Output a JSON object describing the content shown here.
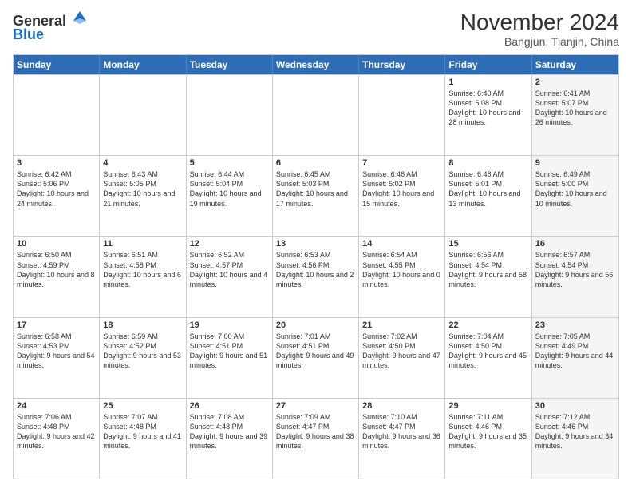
{
  "header": {
    "logo_line1": "General",
    "logo_line2": "Blue",
    "month_title": "November 2024",
    "subtitle": "Bangjun, Tianjin, China"
  },
  "weekdays": [
    "Sunday",
    "Monday",
    "Tuesday",
    "Wednesday",
    "Thursday",
    "Friday",
    "Saturday"
  ],
  "rows": [
    [
      {
        "day": "",
        "text": "",
        "shaded": false
      },
      {
        "day": "",
        "text": "",
        "shaded": false
      },
      {
        "day": "",
        "text": "",
        "shaded": false
      },
      {
        "day": "",
        "text": "",
        "shaded": false
      },
      {
        "day": "",
        "text": "",
        "shaded": false
      },
      {
        "day": "1",
        "text": "Sunrise: 6:40 AM\nSunset: 5:08 PM\nDaylight: 10 hours and 28 minutes.",
        "shaded": false
      },
      {
        "day": "2",
        "text": "Sunrise: 6:41 AM\nSunset: 5:07 PM\nDaylight: 10 hours and 26 minutes.",
        "shaded": true
      }
    ],
    [
      {
        "day": "3",
        "text": "Sunrise: 6:42 AM\nSunset: 5:06 PM\nDaylight: 10 hours and 24 minutes.",
        "shaded": false
      },
      {
        "day": "4",
        "text": "Sunrise: 6:43 AM\nSunset: 5:05 PM\nDaylight: 10 hours and 21 minutes.",
        "shaded": false
      },
      {
        "day": "5",
        "text": "Sunrise: 6:44 AM\nSunset: 5:04 PM\nDaylight: 10 hours and 19 minutes.",
        "shaded": false
      },
      {
        "day": "6",
        "text": "Sunrise: 6:45 AM\nSunset: 5:03 PM\nDaylight: 10 hours and 17 minutes.",
        "shaded": false
      },
      {
        "day": "7",
        "text": "Sunrise: 6:46 AM\nSunset: 5:02 PM\nDaylight: 10 hours and 15 minutes.",
        "shaded": false
      },
      {
        "day": "8",
        "text": "Sunrise: 6:48 AM\nSunset: 5:01 PM\nDaylight: 10 hours and 13 minutes.",
        "shaded": false
      },
      {
        "day": "9",
        "text": "Sunrise: 6:49 AM\nSunset: 5:00 PM\nDaylight: 10 hours and 10 minutes.",
        "shaded": true
      }
    ],
    [
      {
        "day": "10",
        "text": "Sunrise: 6:50 AM\nSunset: 4:59 PM\nDaylight: 10 hours and 8 minutes.",
        "shaded": false
      },
      {
        "day": "11",
        "text": "Sunrise: 6:51 AM\nSunset: 4:58 PM\nDaylight: 10 hours and 6 minutes.",
        "shaded": false
      },
      {
        "day": "12",
        "text": "Sunrise: 6:52 AM\nSunset: 4:57 PM\nDaylight: 10 hours and 4 minutes.",
        "shaded": false
      },
      {
        "day": "13",
        "text": "Sunrise: 6:53 AM\nSunset: 4:56 PM\nDaylight: 10 hours and 2 minutes.",
        "shaded": false
      },
      {
        "day": "14",
        "text": "Sunrise: 6:54 AM\nSunset: 4:55 PM\nDaylight: 10 hours and 0 minutes.",
        "shaded": false
      },
      {
        "day": "15",
        "text": "Sunrise: 6:56 AM\nSunset: 4:54 PM\nDaylight: 9 hours and 58 minutes.",
        "shaded": false
      },
      {
        "day": "16",
        "text": "Sunrise: 6:57 AM\nSunset: 4:54 PM\nDaylight: 9 hours and 56 minutes.",
        "shaded": true
      }
    ],
    [
      {
        "day": "17",
        "text": "Sunrise: 6:58 AM\nSunset: 4:53 PM\nDaylight: 9 hours and 54 minutes.",
        "shaded": false
      },
      {
        "day": "18",
        "text": "Sunrise: 6:59 AM\nSunset: 4:52 PM\nDaylight: 9 hours and 53 minutes.",
        "shaded": false
      },
      {
        "day": "19",
        "text": "Sunrise: 7:00 AM\nSunset: 4:51 PM\nDaylight: 9 hours and 51 minutes.",
        "shaded": false
      },
      {
        "day": "20",
        "text": "Sunrise: 7:01 AM\nSunset: 4:51 PM\nDaylight: 9 hours and 49 minutes.",
        "shaded": false
      },
      {
        "day": "21",
        "text": "Sunrise: 7:02 AM\nSunset: 4:50 PM\nDaylight: 9 hours and 47 minutes.",
        "shaded": false
      },
      {
        "day": "22",
        "text": "Sunrise: 7:04 AM\nSunset: 4:50 PM\nDaylight: 9 hours and 45 minutes.",
        "shaded": false
      },
      {
        "day": "23",
        "text": "Sunrise: 7:05 AM\nSunset: 4:49 PM\nDaylight: 9 hours and 44 minutes.",
        "shaded": true
      }
    ],
    [
      {
        "day": "24",
        "text": "Sunrise: 7:06 AM\nSunset: 4:48 PM\nDaylight: 9 hours and 42 minutes.",
        "shaded": false
      },
      {
        "day": "25",
        "text": "Sunrise: 7:07 AM\nSunset: 4:48 PM\nDaylight: 9 hours and 41 minutes.",
        "shaded": false
      },
      {
        "day": "26",
        "text": "Sunrise: 7:08 AM\nSunset: 4:48 PM\nDaylight: 9 hours and 39 minutes.",
        "shaded": false
      },
      {
        "day": "27",
        "text": "Sunrise: 7:09 AM\nSunset: 4:47 PM\nDaylight: 9 hours and 38 minutes.",
        "shaded": false
      },
      {
        "day": "28",
        "text": "Sunrise: 7:10 AM\nSunset: 4:47 PM\nDaylight: 9 hours and 36 minutes.",
        "shaded": false
      },
      {
        "day": "29",
        "text": "Sunrise: 7:11 AM\nSunset: 4:46 PM\nDaylight: 9 hours and 35 minutes.",
        "shaded": false
      },
      {
        "day": "30",
        "text": "Sunrise: 7:12 AM\nSunset: 4:46 PM\nDaylight: 9 hours and 34 minutes.",
        "shaded": true
      }
    ]
  ]
}
